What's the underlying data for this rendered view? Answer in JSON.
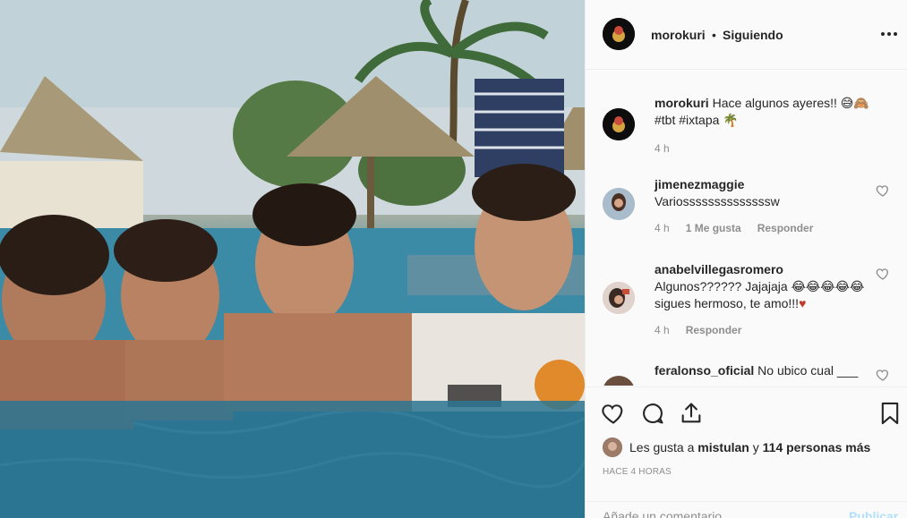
{
  "post": {
    "username": "morokuri",
    "separator": "•",
    "follow_state": "Siguiendo"
  },
  "comments": [
    {
      "user": "morokuri",
      "text": "Hace algunos ayeres!! 😅🙈 #tbt #ixtapa 🌴",
      "time": "4 h",
      "likes": "",
      "reply": ""
    },
    {
      "user": "jimenezmaggie",
      "text": "Variossssssssssssssw",
      "time": "4 h",
      "likes": "1 Me gusta",
      "reply": "Responder"
    },
    {
      "user": "anabelvillegasromero",
      "text": "Algunos?????? Jajajaja 😂😂😂😂😂 sigues hermoso, te amo!!!",
      "heart": "♥",
      "time": "4 h",
      "likes": "",
      "reply": "Responder"
    },
    {
      "user": "feralonso_oficial",
      "text": "No ubico cual ___"
    }
  ],
  "likes": {
    "prefix": "Les gusta a",
    "user": "mistulan",
    "connector": "y",
    "others": "114 personas más"
  },
  "timestamp": "HACE 4 HORAS",
  "add_comment": {
    "placeholder": "Añade un comentario...",
    "publish": "Publicar"
  },
  "icons": [
    "more-icon",
    "heart-icon",
    "comment-icon",
    "share-icon",
    "bookmark-icon"
  ],
  "colors": {
    "heart_red": "#c0392b",
    "publish_blue": "#b2dffc",
    "meta_gray": "#8e8e8e"
  }
}
